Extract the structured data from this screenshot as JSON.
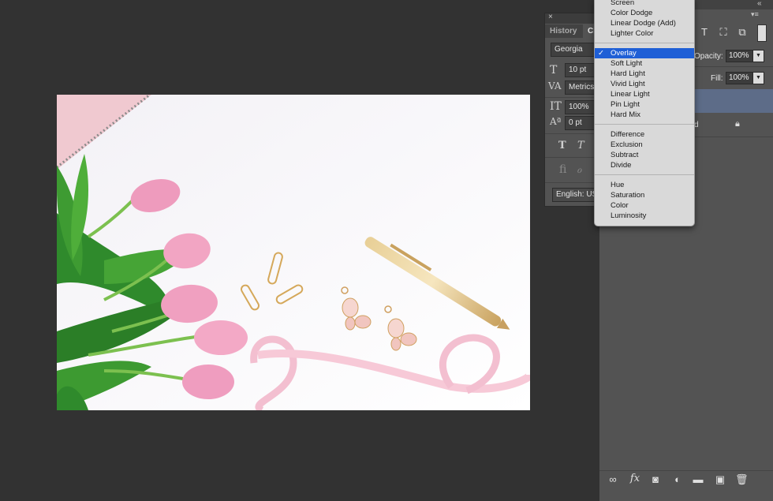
{
  "character_panel": {
    "tabs": [
      "History",
      "Ch"
    ],
    "font_family": "Georgia",
    "font_size": "10 pt",
    "kerning": "Metrics",
    "vertical_scale": "100%",
    "baseline_shift": "0 pt",
    "language": "English: US"
  },
  "blend_menu": {
    "selected": "Overlay",
    "groups": [
      [
        "Screen",
        "Color Dodge",
        "Linear Dodge (Add)",
        "Lighter Color"
      ],
      [
        "Overlay",
        "Soft Light",
        "Hard Light",
        "Vivid Light",
        "Linear Light",
        "Pin Light",
        "Hard Mix"
      ],
      [
        "Difference",
        "Exclusion",
        "Subtract",
        "Divide"
      ],
      [
        "Hue",
        "Saturation",
        "Color",
        "Luminosity"
      ]
    ]
  },
  "layers_panel": {
    "opacity_label": "Opacity:",
    "opacity_value": "100%",
    "fill_label": "Fill:",
    "fill_value": "100%",
    "background_layer_suffix": "d"
  },
  "colors": {
    "workspace": "#323232",
    "panel": "#535353",
    "selected_layer": "#5d6c88",
    "menu_selection": "#1f5fd6"
  }
}
